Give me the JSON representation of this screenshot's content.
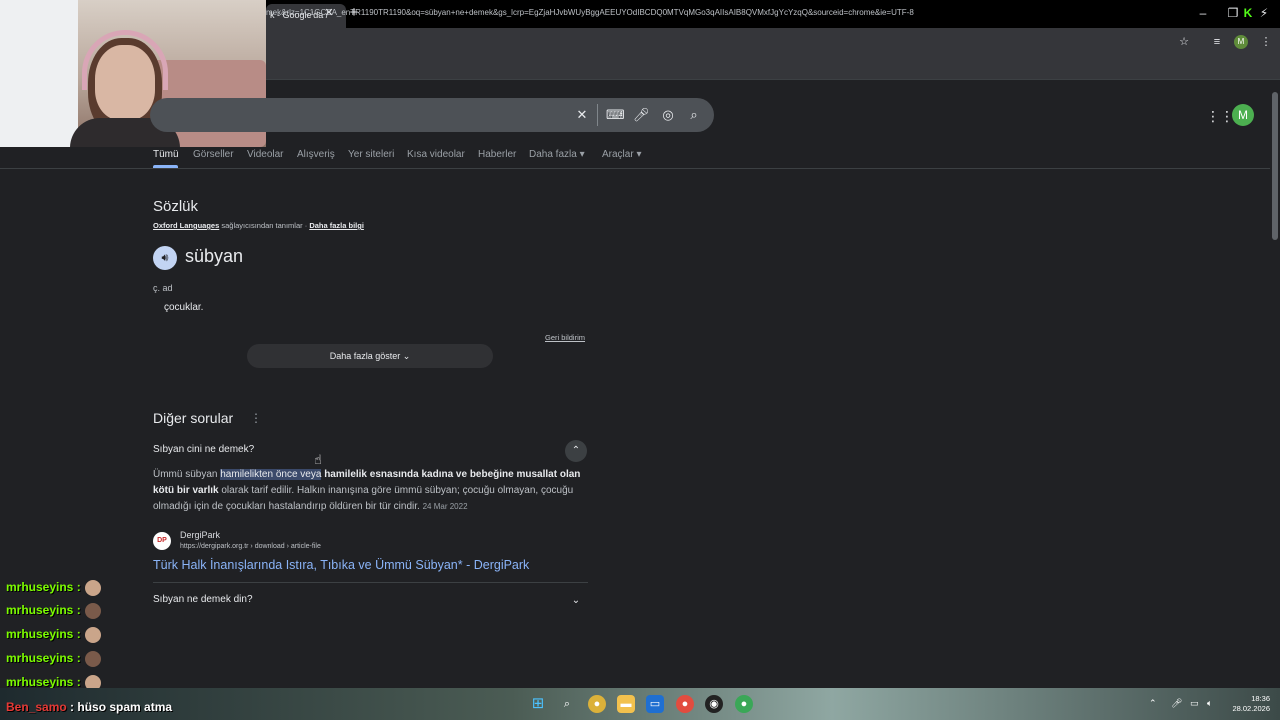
{
  "browser": {
    "tab_title": "k - Google'da /",
    "tab_close": "✕",
    "new_tab": "+",
    "url": "mek&rlz=1C1GCEA_enTR1190TR1190&oq=sübyan+ne+demek&gs_lcrp=EgZjaHJvbWUyBggAEEUYOdIBCDQ0MTVqMGo3qAIIsAIB8QVMxfJgYcYzqQ&sourceid=chrome&ie=UTF-8",
    "profile_initial": "M"
  },
  "google": {
    "avatar_initial": "M",
    "tabs": [
      "Tümü",
      "Görseller",
      "Videolar",
      "Alışveriş",
      "Yer siteleri",
      "Kısa videolar",
      "Haberler",
      "Daha fazla ▾",
      "Araçlar ▾"
    ]
  },
  "dictionary": {
    "heading": "Sözlük",
    "provider_name": "Oxford Languages",
    "provider_suffix": " sağlayıcısından tanımlar · ",
    "more_info": "Daha fazla bilgi",
    "word": "sübyan",
    "part_of_speech": "ç. ad",
    "definition": "çocuklar.",
    "feedback": "Geri bildirim",
    "show_more": "Daha fazla göster ⌄"
  },
  "questions": {
    "heading": "Diğer sorular",
    "q1": "Sıbyan cini ne demek?",
    "answer_plain1": "Ümmü sübyan ",
    "answer_highlight": "hamilelikten önce veya",
    "answer_bold": " hamilelik esnasında kadına ve bebeğine musallat olan kötü bir varlık",
    "answer_plain2": " olarak tarif edilir. Halkın inanışına göre ümmü sübyan; çocuğu olmayan, çocuğu olmadığı için de çocukları hastalandırıp öldüren bir tür cindir.",
    "answer_date": "24 Mar 2022",
    "source_logo": "DP",
    "source_name": "DergiPark",
    "source_url": "https://dergipark.org.tr › download › article-file",
    "result_title": "Türk Halk İnanışlarında Istıra, Tıbıka ve Ümmü Sübyan* - DergiPark",
    "q2": "Sıbyan ne demek din?"
  },
  "chat": {
    "lines": [
      "mrhuseyins :",
      "mrhuseyins :",
      "mrhuseyins :",
      "mrhuseyins :",
      "mrhuseyins :"
    ],
    "last_name": "Ben_samo",
    "last_message": " : hüso spam atma"
  },
  "taskbar": {
    "time": "18:36",
    "date": "28.02.2026"
  }
}
